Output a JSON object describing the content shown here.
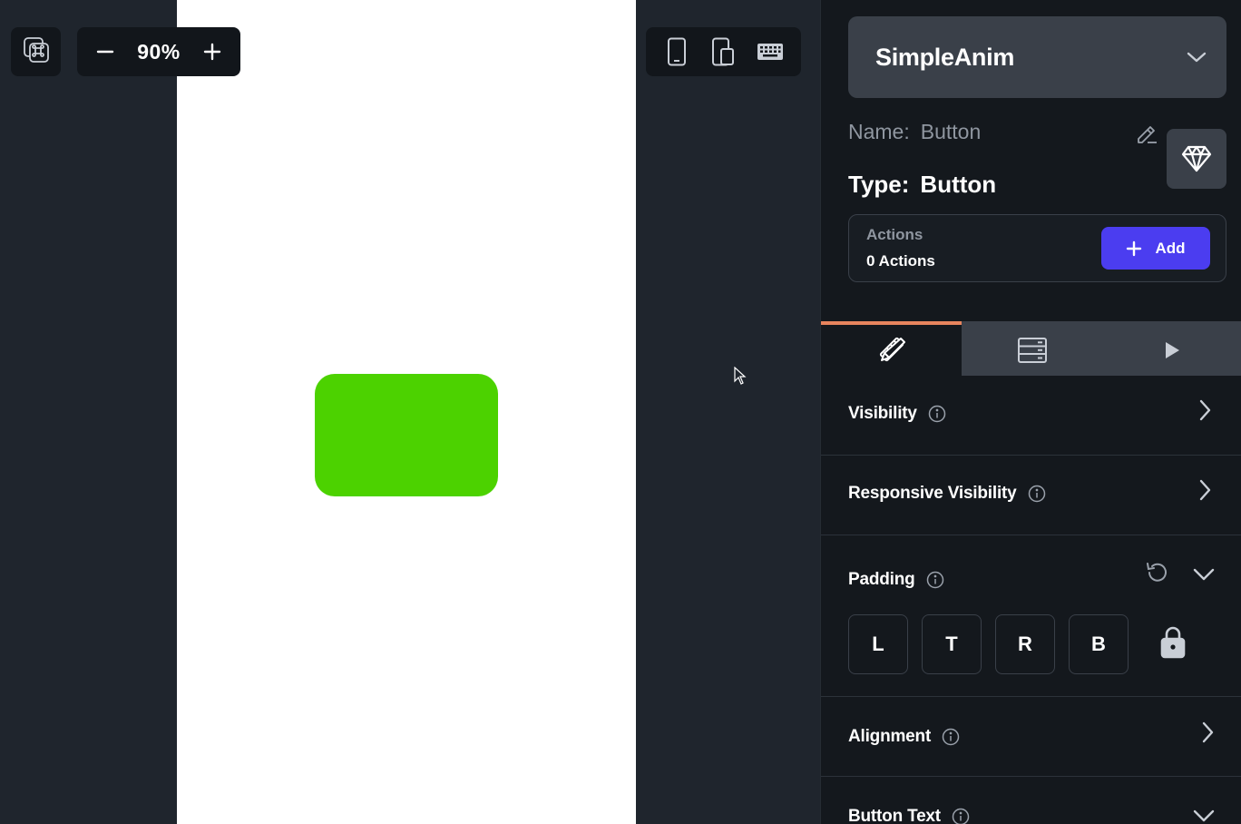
{
  "toolbar": {
    "zoom_value": "90%"
  },
  "panel": {
    "project_name": "SimpleAnim",
    "name_label": "Name:",
    "name_value": "Button",
    "type_label": "Type:",
    "type_value": "Button",
    "actions": {
      "title": "Actions",
      "count": "0 Actions",
      "add_label": "Add"
    },
    "sections": {
      "visibility": "Visibility",
      "responsive_visibility": "Responsive Visibility",
      "padding": "Padding",
      "alignment": "Alignment",
      "button_text": "Button Text"
    },
    "padding_fields": [
      "L",
      "T",
      "R",
      "B"
    ]
  },
  "colors": {
    "accent": "#4b3df0",
    "tab_indicator": "#e8845d",
    "widget_green": "#4cd200"
  }
}
